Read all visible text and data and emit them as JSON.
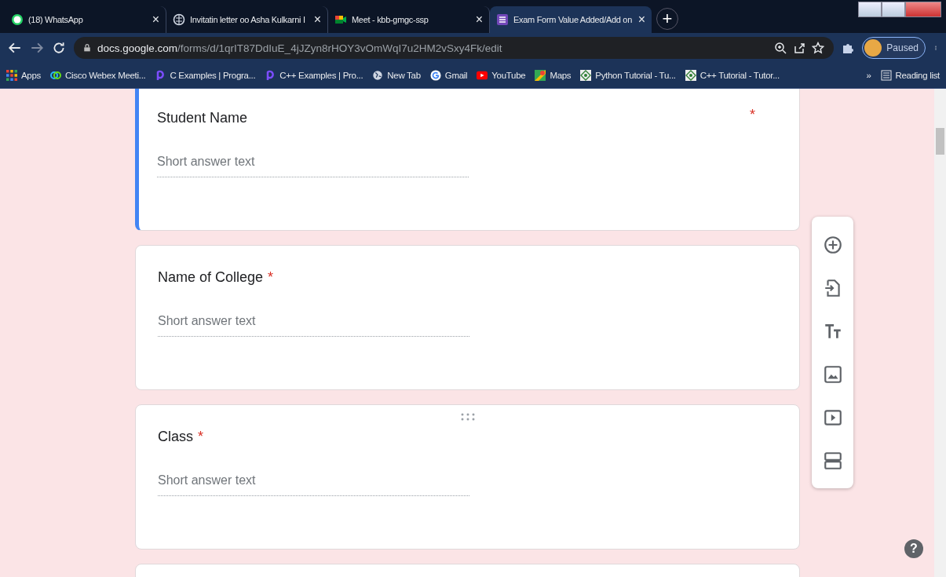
{
  "tabs": [
    {
      "title": "(18) WhatsApp",
      "selected": false
    },
    {
      "title": "Invitatin letter oo Asha Kulkarni I",
      "selected": false
    },
    {
      "title": "Meet - kbb-gmgc-ssp",
      "selected": false
    },
    {
      "title": "Exam Form Value Added/Add on",
      "selected": true
    }
  ],
  "tab_close": "×",
  "new_tab": "+",
  "address": {
    "host": "docs.google.com",
    "path": "/forms/d/1qrIT87DdIuE_4jJZyn8rHOY3vOmWqI7u2HM2vSxy4Fk/edit"
  },
  "profile": {
    "label": "Paused"
  },
  "bookmarks": [
    "Apps",
    "Cisco Webex Meeti...",
    "C Examples | Progra...",
    "C++ Examples | Pro...",
    "New Tab",
    "Gmail",
    "YouTube",
    "Maps",
    "Python Tutorial - Tu...",
    "C++ Tutorial - Tutor..."
  ],
  "bookmarks_more": "»",
  "reading_list": "Reading list",
  "questions": [
    {
      "title": "Student Name",
      "placeholder": "Short answer text",
      "required": true,
      "selected": true,
      "drag_handle": false
    },
    {
      "title": "Name of College",
      "placeholder": "Short answer text",
      "required": true,
      "selected": false,
      "drag_handle": false
    },
    {
      "title": "Class",
      "placeholder": "Short answer text",
      "required": true,
      "selected": false,
      "drag_handle": true
    }
  ],
  "required_mark": "*",
  "help": "?"
}
